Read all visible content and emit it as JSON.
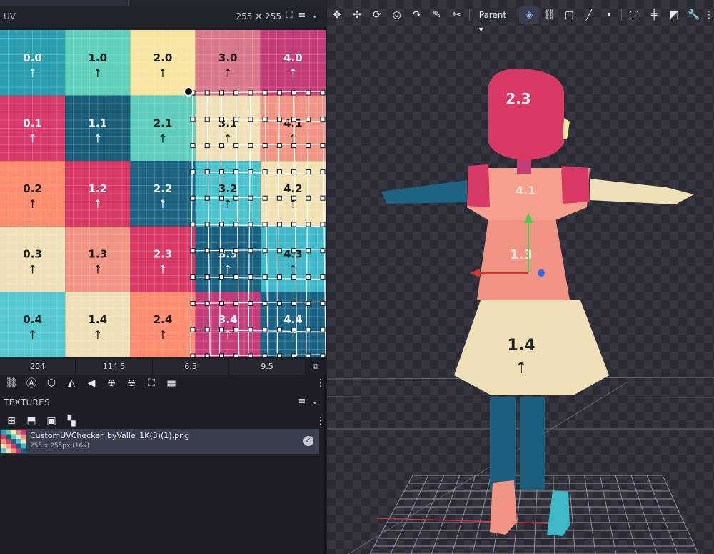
{
  "uv_panel": {
    "title": "UV",
    "size_label": "255 ✕ 255",
    "tile_grid": [
      [
        "0.0",
        "1.0",
        "2.0",
        "3.0",
        "4.0"
      ],
      [
        "0.1",
        "1.1",
        "2.1",
        "3.1",
        "4.1"
      ],
      [
        "0.2",
        "1.2",
        "2.2",
        "3.2",
        "4.2"
      ],
      [
        "0.3",
        "1.3",
        "2.3",
        "3.3",
        "4.3"
      ],
      [
        "0.4",
        "1.4",
        "2.4",
        "3.4",
        "4.4"
      ]
    ],
    "tile_colors": [
      [
        "#2a9fb0",
        "#5fd0bb",
        "#f6e6a2",
        "#d9788a",
        "#c43d78"
      ],
      [
        "#d73a6b",
        "#195d78",
        "#5fcdbc",
        "#efe0b7",
        "#f19483"
      ],
      [
        "#ff8c6e",
        "#d83a65",
        "#1c6482",
        "#4ac3cc",
        "#f1e0b3"
      ],
      [
        "#efe0b7",
        "#f19483",
        "#d83a65",
        "#1a5f7d",
        "#3fb8c8"
      ],
      [
        "#55c9cf",
        "#efe0b7",
        "#ff8c6e",
        "#c43d78",
        "#1a6385"
      ]
    ],
    "values": [
      "204",
      "114.5",
      "6.5",
      "9.5"
    ],
    "tools": [
      "link-icon",
      "auto-unwrap-icon",
      "project-icon",
      "mirror-icon",
      "flip-icon",
      "zoom-in-icon",
      "zoom-out-icon",
      "fit-icon",
      "grid-icon"
    ]
  },
  "textures_panel": {
    "title": "TEXTURES",
    "tools": [
      "add-texture-icon",
      "import-icon",
      "folder-icon",
      "plugin-icon"
    ],
    "items": [
      {
        "name": "CustomUVChecker_byValle_1K(3)(1).png",
        "meta": "255 x 255px (16x)"
      }
    ]
  },
  "viewport": {
    "parent_label": "Parent",
    "tools": [
      "move-tool-icon",
      "move-icon",
      "rotate-icon",
      "pivot-icon",
      "vertex-snap-icon",
      "paint-icon",
      "cut-icon"
    ],
    "mode_tools": [
      "face-mode-icon",
      "edge-link-icon",
      "rect-select-icon",
      "line-icon",
      "point-icon"
    ],
    "right_tools": [
      "select-all-icon",
      "center-icon",
      "contrast-icon",
      "wrench-icon"
    ],
    "model_labels": {
      "head": "2.3",
      "chest": "4.1",
      "waist": "1.3",
      "skirt": "1.4"
    }
  },
  "colors": {
    "accent": "#8fb8ff",
    "panel": "#1e1f26",
    "selection": "#ffffff"
  }
}
